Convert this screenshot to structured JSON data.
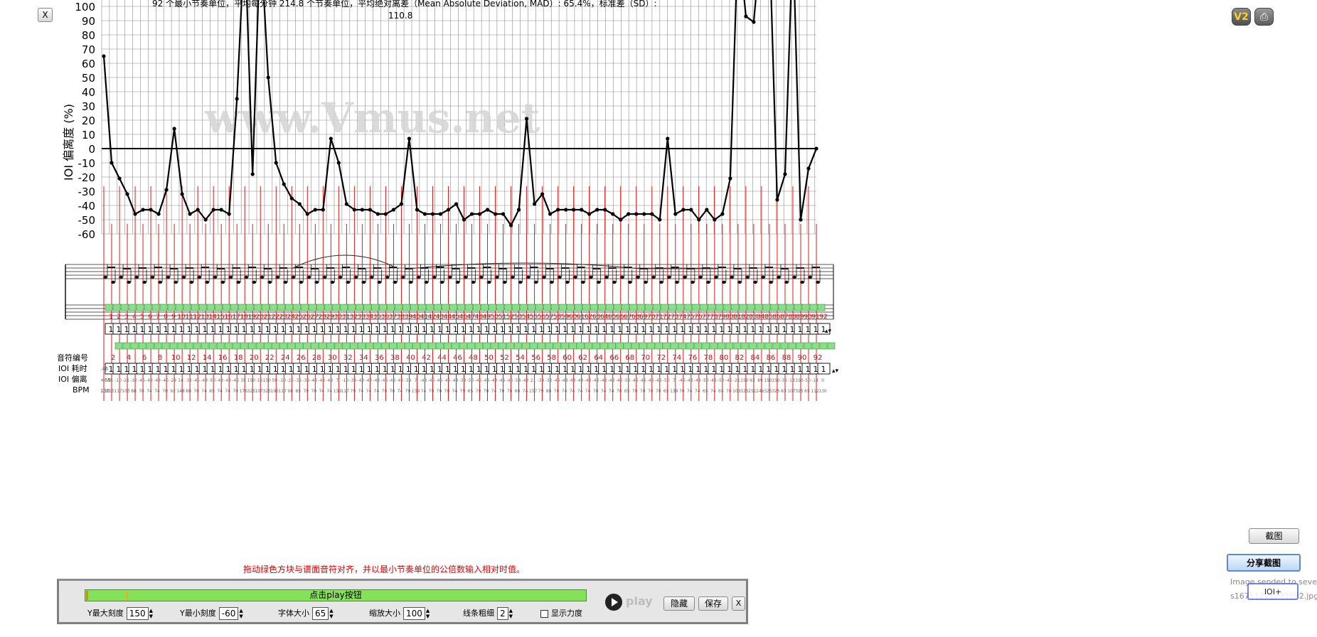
{
  "summary_line1": "92 个最小节奏单位，平均每分钟 214.8 个节奏单位，平均绝对离差（Mean Absolute Deviation, MAD）: 65.4%，标准差（SD）:",
  "summary_line2": "110.8",
  "watermark": "www.Vmus.net",
  "row_labels": {
    "note_number": "音符编号",
    "ioi_duration": "IOI 耗时",
    "ioi_deviation": "IOI 偏离",
    "bpm": "BPM"
  },
  "row_values": {
    "ioi_duration_first": ".46",
    "ioi_deviation_first": "+65",
    "bpm_first": "130",
    "duration_cell": "1"
  },
  "chart_data": {
    "type": "line",
    "ylabel": "IOI 偏离度 (%)",
    "ylim": [
      -60,
      100
    ],
    "yticks": [
      100,
      90,
      80,
      70,
      60,
      50,
      40,
      30,
      20,
      10,
      0,
      -10,
      -20,
      -30,
      -40,
      -50,
      -60
    ],
    "grid": true,
    "x": [
      1,
      2,
      3,
      4,
      5,
      6,
      7,
      8,
      9,
      10,
      11,
      12,
      13,
      14,
      15,
      16,
      17,
      18,
      19,
      20,
      21,
      22,
      23,
      24,
      25,
      26,
      27,
      28,
      29,
      30,
      31,
      32,
      33,
      34,
      35,
      36,
      37,
      38,
      39,
      40,
      41,
      42,
      43,
      44,
      45,
      46,
      47,
      48,
      49,
      50,
      51,
      52,
      53,
      54,
      55,
      56,
      57,
      58,
      59,
      60,
      61,
      62,
      63,
      64,
      65,
      66,
      67,
      68,
      69,
      70,
      71,
      72,
      73,
      74,
      75,
      76,
      77,
      78,
      79,
      80,
      81,
      82,
      83,
      84,
      85,
      86,
      87,
      88,
      89,
      90,
      91,
      92
    ],
    "values": [
      65,
      -10,
      -21,
      -32,
      -46,
      -43,
      -43,
      -46,
      -29,
      14,
      -32,
      -46,
      -43,
      -50,
      -43,
      -43,
      -46,
      35,
      150,
      -18,
      150,
      50,
      -10,
      -25,
      -35,
      -39,
      -46,
      -43,
      -43,
      7,
      -10,
      -39,
      -43,
      -43,
      -43,
      -46,
      -46,
      -43,
      -39,
      7,
      -43,
      -46,
      -46,
      -46,
      -43,
      -39,
      -50,
      -46,
      -46,
      -43,
      -46,
      -46,
      -54,
      -43,
      21,
      -39,
      -32,
      -46,
      -43,
      -43,
      -43,
      -43,
      -46,
      -43,
      -43,
      -46,
      -50,
      -46,
      -46,
      -46,
      -46,
      -50,
      7,
      -46,
      -43,
      -43,
      -50,
      -43,
      -50,
      -46,
      -21,
      150,
      93,
      89,
      150,
      150,
      -36,
      -18,
      150,
      -50,
      -14,
      0
    ],
    "note_numbers": [
      2,
      4,
      6,
      8,
      10,
      12,
      14,
      16,
      18,
      20,
      22,
      24,
      26,
      28,
      30,
      32,
      34,
      36,
      38,
      40,
      42,
      44,
      46,
      48,
      50,
      52,
      54,
      56,
      58,
      60,
      62,
      64,
      66,
      68,
      70,
      72,
      74,
      76,
      78,
      80,
      82,
      84,
      86,
      88,
      90,
      92
    ],
    "series_color": "#000000",
    "guide_color": "#e00000"
  },
  "buttons": {
    "close": "X",
    "hide": "隐藏",
    "save": "保存",
    "panel_close": "X",
    "screenshot": "截图",
    "share": "分享截图",
    "ioi_plus": "IOI+"
  },
  "icons": {
    "v2": "V2",
    "print": "⎙"
  },
  "side_note_line1": "Image sended to seve",
  "side_note_line2": "s16711271273992.jpg",
  "instruction": "拖动绿色方块与谱面音符对齐，并以最小节奏单位的公倍数输入相对时值。",
  "player": {
    "progress_label": "点击play按钮",
    "play_label": "play",
    "y_max_label": "Y最大刻度",
    "y_max": "150",
    "y_min_label": "Y最小刻度",
    "y_min": "-60",
    "font_size_label": "字体大小",
    "font_size": "65",
    "zoom_label": "缩放大小",
    "zoom": "100",
    "line_width_label": "线条粗细",
    "line_width": "2",
    "show_force_label": "显示力度"
  },
  "colors": {
    "accent_green": "#86e05a",
    "marker_green": "#6ecf6e",
    "red": "#e00000"
  }
}
